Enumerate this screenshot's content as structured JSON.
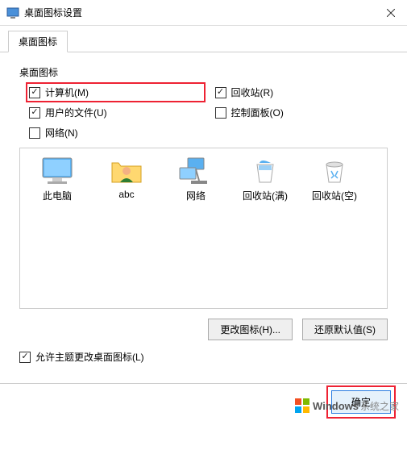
{
  "titlebar": {
    "title": "桌面图标设置"
  },
  "tab": {
    "label": "桌面图标"
  },
  "group": {
    "label": "桌面图标"
  },
  "checkboxes": {
    "computer": {
      "label": "计算机(M)",
      "checked": true,
      "highlighted": true
    },
    "recycle": {
      "label": "回收站(R)",
      "checked": true
    },
    "userfiles": {
      "label": "用户的文件(U)",
      "checked": true
    },
    "control": {
      "label": "控制面板(O)",
      "checked": false
    },
    "network": {
      "label": "网络(N)",
      "checked": false
    }
  },
  "icons": [
    {
      "name": "this-pc",
      "label": "此电脑"
    },
    {
      "name": "user-folder",
      "label": "abc"
    },
    {
      "name": "network",
      "label": "网络"
    },
    {
      "name": "recycle-full",
      "label": "回收站(满)"
    },
    {
      "name": "recycle-empty",
      "label": "回收站(空)"
    }
  ],
  "buttons": {
    "change_icon": "更改图标(H)...",
    "restore_default": "还原默认值(S)",
    "ok": "确定"
  },
  "allow_theme": {
    "label": "允许主题更改桌面图标(L)",
    "checked": true
  },
  "watermark": {
    "brand": "Windows",
    "sub": "系统之家"
  }
}
